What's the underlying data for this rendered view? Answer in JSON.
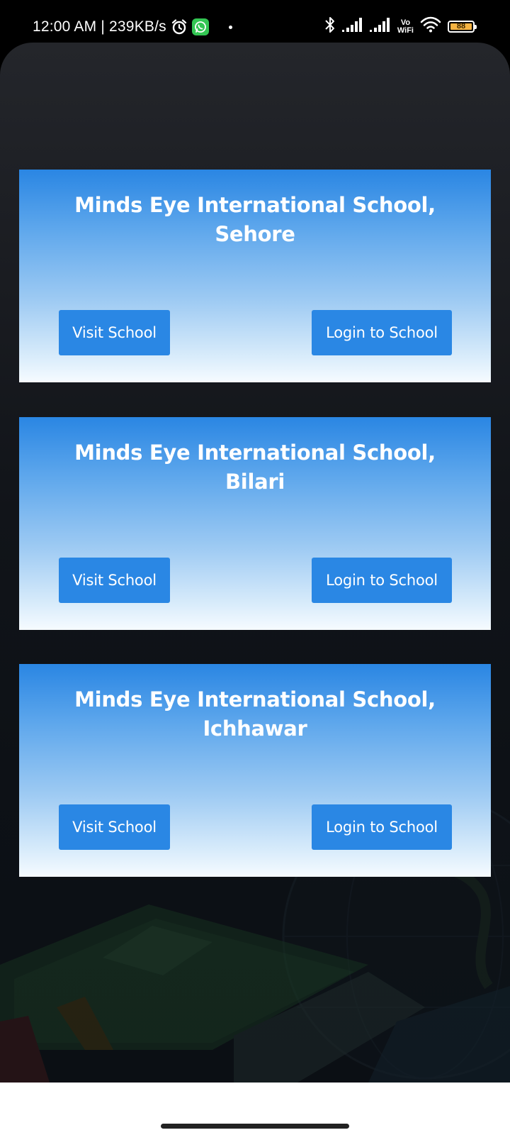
{
  "status_bar": {
    "time_info": "12:00 AM | 239KB/s",
    "vowifi_top": "Vo",
    "vowifi_bottom": "WiFi",
    "battery_level": "88",
    "icons": [
      "alarm-icon",
      "whatsapp-icon",
      "dot-icon",
      "bluetooth-icon",
      "signal-icon",
      "signal-icon",
      "wifi-icon",
      "battery-icon"
    ]
  },
  "colors": {
    "card_top": "#2a86e3",
    "card_bottom": "#f6fbff",
    "button": "#2a87e4",
    "background": "#111419"
  },
  "schools": [
    {
      "name_line1": "Minds Eye International School,",
      "name_line2": "Sehore",
      "visit_label": "Visit School",
      "login_label": "Login to School"
    },
    {
      "name_line1": "Minds Eye International School,",
      "name_line2": "Bilari",
      "visit_label": "Visit School",
      "login_label": "Login to School"
    },
    {
      "name_line1": "Minds Eye International School,",
      "name_line2": "Ichhawar",
      "visit_label": "Visit School",
      "login_label": "Login to School"
    }
  ]
}
